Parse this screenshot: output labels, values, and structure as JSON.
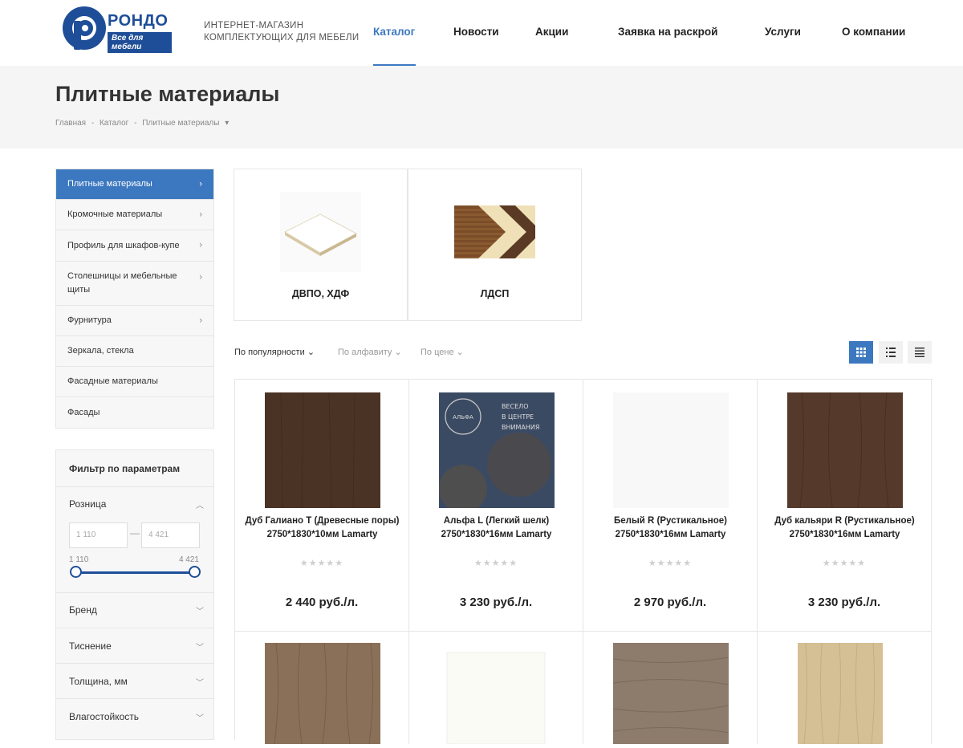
{
  "header": {
    "logo_name": "РОНДО",
    "logo_tagline": "Все для мебели",
    "shop_desc_line1": "ИНТЕРНЕТ-МАГАЗИН",
    "shop_desc_line2": "КОМПЛЕКТУЮЩИХ ДЛЯ МЕБЕЛИ",
    "nav": [
      "Каталог",
      "Новости",
      "Акции",
      "Заявка на раскрой",
      "Услуги",
      "О компании"
    ],
    "active_nav": "Каталог"
  },
  "page": {
    "title": "Плитные материалы",
    "breadcrumb": [
      "Главная",
      "-",
      "Каталог",
      "-",
      "Плитные материалы",
      "▾"
    ]
  },
  "sidebar": {
    "items": [
      {
        "label": "Плитные материалы",
        "has_arrow": true,
        "active": true
      },
      {
        "label": "Кромочные материалы",
        "has_arrow": true
      },
      {
        "label": "Профиль для шкафов-купе",
        "has_arrow": true
      },
      {
        "label": "Столешницы и мебельные щиты",
        "has_arrow": true
      },
      {
        "label": "Фурнитура",
        "has_arrow": true
      },
      {
        "label": "Зеркала, стекла",
        "has_arrow": false
      },
      {
        "label": "Фасадные материалы",
        "has_arrow": false
      },
      {
        "label": "Фасады",
        "has_arrow": false
      }
    ]
  },
  "filter": {
    "title": "Фильтр по параметрам",
    "price_group": "Розница",
    "min_placeholder": "1 110",
    "max_placeholder": "4 421",
    "range_dash": "—",
    "range_min_label": "1 110",
    "range_max_label": "4 421",
    "groups": [
      "Бренд",
      "Тиснение",
      "Толщина, мм",
      "Влагостойкость"
    ]
  },
  "categories": [
    {
      "name": "ДВПО, ХДФ"
    },
    {
      "name": "ЛДСП"
    }
  ],
  "sort": {
    "options": [
      "По популярности",
      "По алфавиту",
      "По цене"
    ],
    "active": "По популярности",
    "chevron": "⌄"
  },
  "view_modes": [
    "grid-icon",
    "list-icon",
    "table-icon"
  ],
  "products": [
    {
      "name": "Дуб Галиано Т (Древесные поры) 2750*1830*10мм Lamarty",
      "price": "2 440 руб./л.",
      "rating": 0,
      "stars": "★★★★★",
      "swatch": "#4a3325"
    },
    {
      "name": "Альфа L (Легкий шелк) 2750*1830*16мм Lamarty",
      "price": "3 230 руб./л.",
      "rating": 0,
      "stars": "★★★★★",
      "swatch": "#3b4a63",
      "overlay_text": [
        "АЛЬФА",
        "ВЕСЕЛО",
        "В ЦЕНТРЕ",
        "ВНИМАНИЯ"
      ]
    },
    {
      "name": "Белый R (Рустикальное) 2750*1830*16мм Lamarty",
      "price": "2 970 руб./л.",
      "rating": 0,
      "stars": "★★★★★",
      "swatch": "#f8f8f8"
    },
    {
      "name": "Дуб кальяри R (Рустикальное) 2750*1830*16мм Lamarty",
      "price": "3 230 руб./л.",
      "rating": 0,
      "stars": "★★★★★",
      "swatch": "#553a2c"
    }
  ],
  "products_row2": [
    {
      "swatch": "#8a7058"
    },
    {
      "swatch": "#fbfbf6"
    },
    {
      "swatch": "#8d7b6b"
    },
    {
      "swatch": "#d5bf94"
    }
  ],
  "colors": {
    "accent": "#3c78c0",
    "brand": "#1f4e98",
    "band": "#f5f5f5"
  }
}
